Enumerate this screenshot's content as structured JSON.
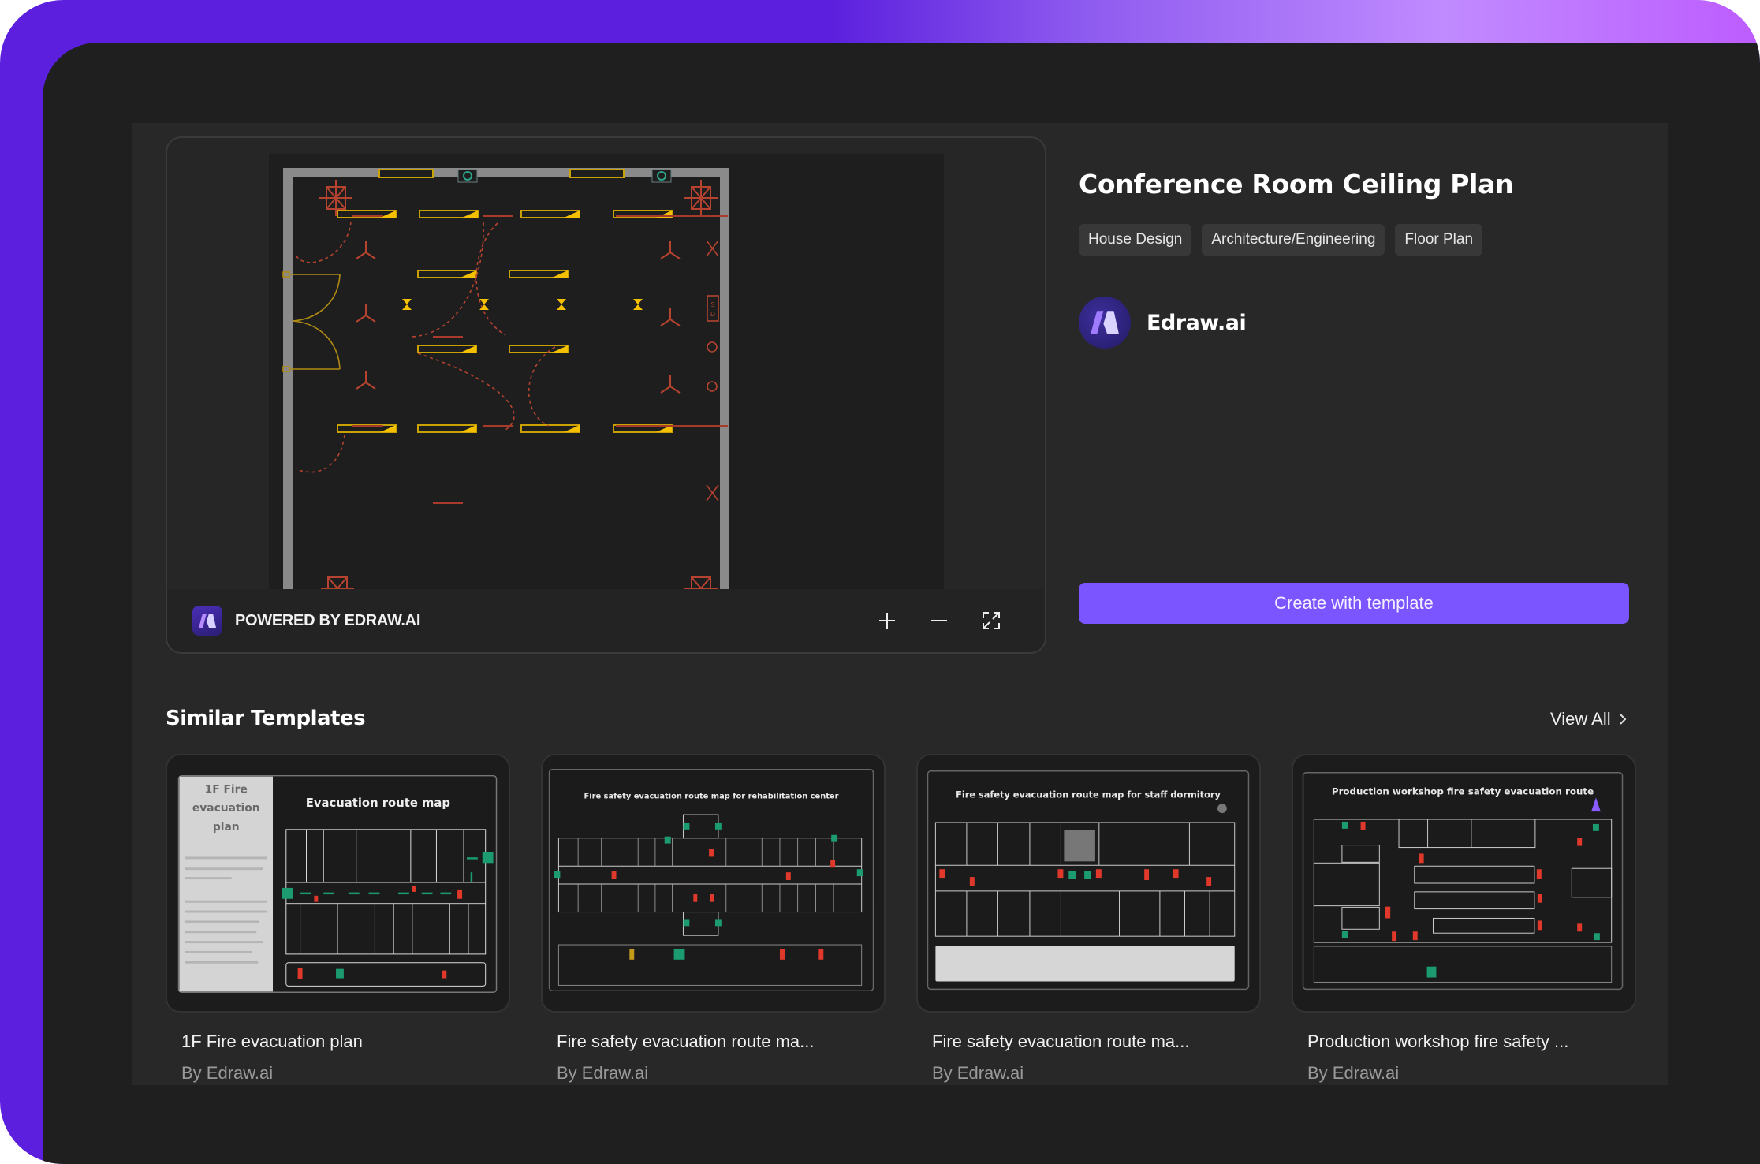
{
  "template": {
    "title": "Conference Room Ceiling Plan",
    "tags": [
      "House Design",
      "Architecture/Engineering",
      "Floor Plan"
    ],
    "author": "Edraw.ai",
    "create_button": "Create with template"
  },
  "preview": {
    "powered_by": "POWERED BY EDRAW.AI",
    "controls": {
      "zoom_in_icon": "plus-icon",
      "zoom_out_icon": "minus-icon",
      "fullscreen_icon": "expand-icon"
    },
    "plan_labels": {
      "panel_top": "S",
      "panel_bottom": "D"
    }
  },
  "similar": {
    "heading": "Similar Templates",
    "view_all": "View All",
    "items": [
      {
        "title": "1F Fire evacuation plan",
        "byline": "By Edraw.ai",
        "thumb_title": "Evacuation route map",
        "thumb_side_title": "1F Fire evacuation plan"
      },
      {
        "title": "Fire safety evacuation route ma...",
        "byline": "By Edraw.ai",
        "thumb_title": "Fire safety evacuation route map for rehabilitation center"
      },
      {
        "title": "Fire safety evacuation route ma...",
        "byline": "By Edraw.ai",
        "thumb_title": "Fire safety evacuation route map for staff dormitory"
      },
      {
        "title": "Production workshop fire safety ...",
        "byline": "By Edraw.ai",
        "thumb_title": "Production workshop fire safety evacuation route"
      }
    ]
  },
  "colors": {
    "accent": "#7b55ff",
    "frame_gradient_start": "#5b1fdd",
    "frame_gradient_end": "#bd5cff",
    "plan_light": "#f5c000",
    "plan_wire": "#c0392b",
    "plan_fan": "#2aa58a"
  }
}
